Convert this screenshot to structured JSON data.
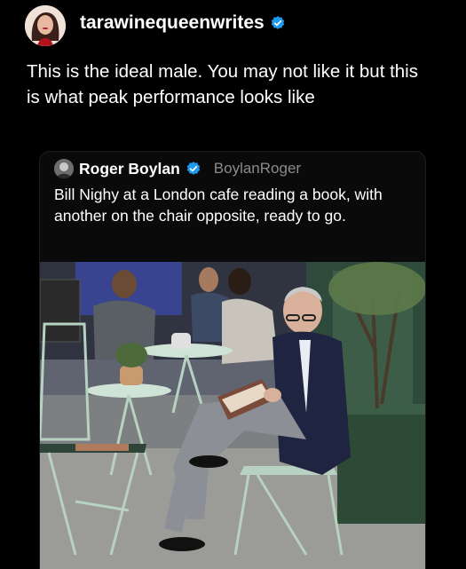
{
  "post": {
    "username": "tarawinequeenwrites",
    "text": "This is the ideal male. You may not like it but this is what peak performance looks like"
  },
  "quote": {
    "name": "Roger Boylan",
    "handle": "BoylanRoger",
    "text": "Bill Nighy at a London cafe reading a book, with another on the chair opposite, ready to go."
  },
  "icons": {
    "verified": "verified-badge-icon"
  },
  "colors": {
    "verified": "#1d9bf0",
    "background": "#000000"
  }
}
